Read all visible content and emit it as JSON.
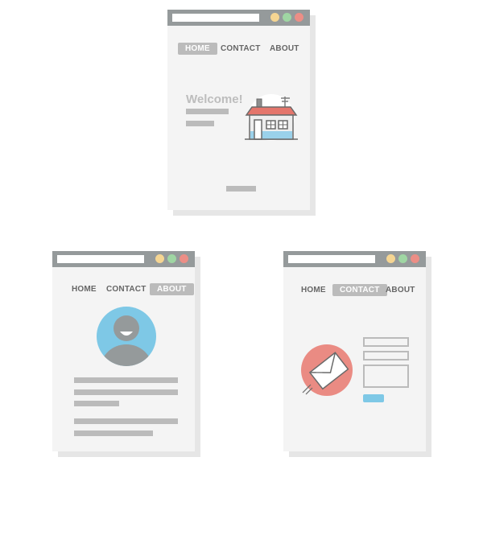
{
  "colors": {
    "titlebar": "#959a9b",
    "page": "#f4f4f4",
    "shadow": "#e6e6e6",
    "placeholder": "#bbbbbb",
    "dot_yellow": "#f5d592",
    "dot_green": "#9fd6a3",
    "dot_red": "#ec8e86",
    "avatar_bg": "#7ec8e6",
    "mail_bg": "#ea8b83",
    "submit_button": "#7ec8e6",
    "house_roof": "#e4766c",
    "house_wall": "#9ad1ea"
  },
  "home_page": {
    "nav": {
      "home": "HOME",
      "contact": "CONTACT",
      "about": "ABOUT"
    },
    "active_tab": "HOME",
    "headline": "Welcome!",
    "illustration": "house-icon"
  },
  "about_page": {
    "nav": {
      "home": "HOME",
      "contact": "CONTACT",
      "about": "ABOUT"
    },
    "active_tab": "ABOUT",
    "illustration": "user-avatar-icon"
  },
  "contact_page": {
    "nav": {
      "home": "HOME",
      "contact": "CONTACT",
      "about": "ABOUT"
    },
    "active_tab": "CONTACT",
    "illustration": "envelope-icon"
  }
}
